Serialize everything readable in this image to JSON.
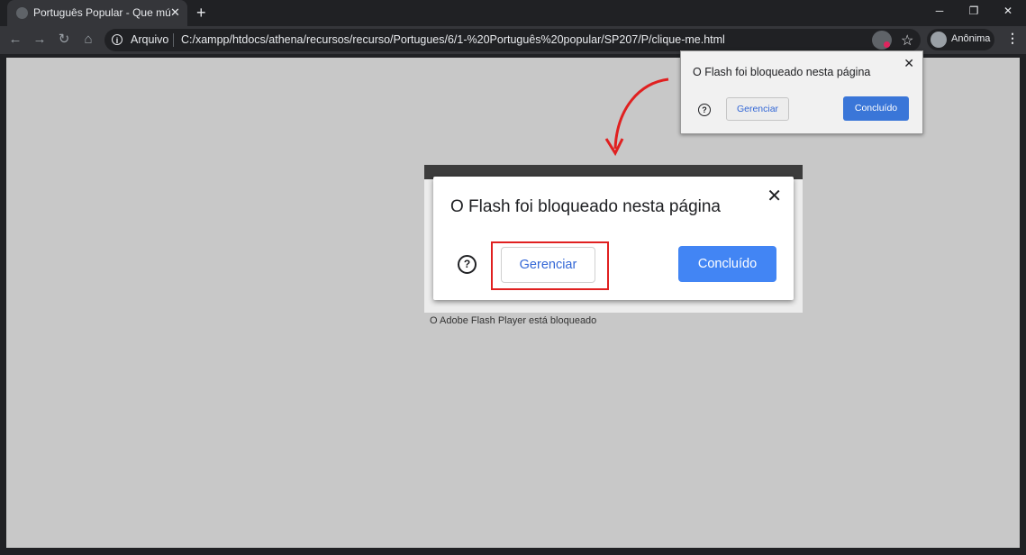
{
  "tab": {
    "title": "Português Popular - Que música",
    "close": "✕"
  },
  "newtab": "+",
  "window": {
    "minimize": "─",
    "restore": "❐",
    "close": "✕"
  },
  "toolbar": {
    "back": "←",
    "forward": "→",
    "reload": "↻",
    "home": "⌂"
  },
  "omnibox": {
    "prefix": "Arquivo",
    "url": "C:/xampp/htdocs/athena/recursos/recurso/Portugues/6/1-%20Português%20popular/SP207/P/clique-me.html"
  },
  "profile": {
    "label": "Anônima"
  },
  "menu": "⋮",
  "star": "☆",
  "popup_small": {
    "title": "O Flash foi bloqueado nesta página",
    "close": "✕",
    "help": "?",
    "manage": "Gerenciar",
    "done": "Concluído"
  },
  "zoomed": {
    "title": "O Flash foi bloqueado nesta página",
    "close": "✕",
    "help": "?",
    "manage": "Gerenciar",
    "done": "Concluído"
  },
  "caption": "O Adobe Flash Player está bloqueado",
  "colors": {
    "accent": "#4285f4",
    "highlight": "#e02020",
    "arrow": "#e02020"
  }
}
